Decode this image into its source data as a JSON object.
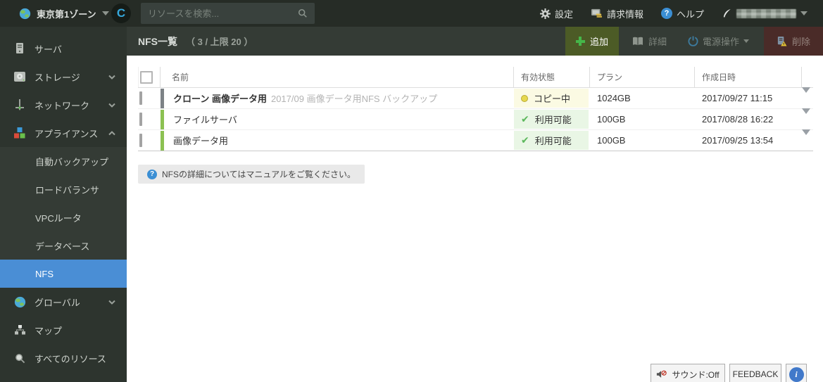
{
  "topbar": {
    "zone_label": "東京第1ゾーン",
    "logo_letter": "C",
    "search_placeholder": "リソースを検索...",
    "settings_label": "設定",
    "billing_label": "請求情報",
    "help_label": "ヘルプ"
  },
  "sidebar": {
    "items": [
      {
        "label": "サーバ"
      },
      {
        "label": "ストレージ"
      },
      {
        "label": "ネットワーク"
      },
      {
        "label": "アプライアンス"
      }
    ],
    "appliance_submenu": [
      "自動バックアップ",
      "ロードバランサ",
      "VPCルータ",
      "データベース",
      "NFS"
    ],
    "selected_item": "NFS",
    "items_lower": [
      {
        "label": "グローバル"
      },
      {
        "label": "マップ"
      },
      {
        "label": "すべてのリソース"
      }
    ]
  },
  "header": {
    "title": "NFS一覧",
    "count": "（ 3 / 上限 20 ）",
    "add_label": "追加",
    "detail_label": "詳細",
    "power_label": "電源操作",
    "delete_label": "削除"
  },
  "table": {
    "columns": {
      "name": "名前",
      "status": "有効状態",
      "plan": "プラン",
      "created": "作成日時"
    },
    "rows": [
      {
        "name": "クローン 画像データ用",
        "name_suffix": "2017/09 画像データ用NFS バックアップ",
        "status": "コピー中",
        "status_kind": "copying",
        "plan": "1024GB",
        "created": "2017/09/27 11:15"
      },
      {
        "name": "ファイルサーバ",
        "name_suffix": "",
        "status": "利用可能",
        "status_kind": "available",
        "plan": "100GB",
        "created": "2017/08/28 16:22"
      },
      {
        "name": "画像データ用",
        "name_suffix": "",
        "status": "利用可能",
        "status_kind": "available",
        "plan": "100GB",
        "created": "2017/09/25 13:54"
      }
    ]
  },
  "info_bar": {
    "text": "NFSの詳細についてはマニュアルをご覧ください。"
  },
  "footer": {
    "sound_label": "サウンド:Off",
    "feedback_label": "FEEDBACK"
  },
  "icons": {
    "help_glyph": "?",
    "info_glyph": "i",
    "check_glyph": "✔"
  },
  "colors": {
    "topbar_bg": "#262c26",
    "sidebar_bg": "#2d342e",
    "header_bg": "#343b35",
    "selected_blue": "#4a8ed5",
    "add_btn_bg": "#4c5b26",
    "delete_btn_bg": "#4a2b28",
    "accent_green": "#45b649",
    "status_copying_bg": "#fbfae3",
    "status_copying_dot": "#e6d84e",
    "status_available_bg": "#e9f6e5",
    "status_available_check": "#5cb85c",
    "row_bar_gray": "#7d8286",
    "row_bar_green": "#8cc152"
  }
}
